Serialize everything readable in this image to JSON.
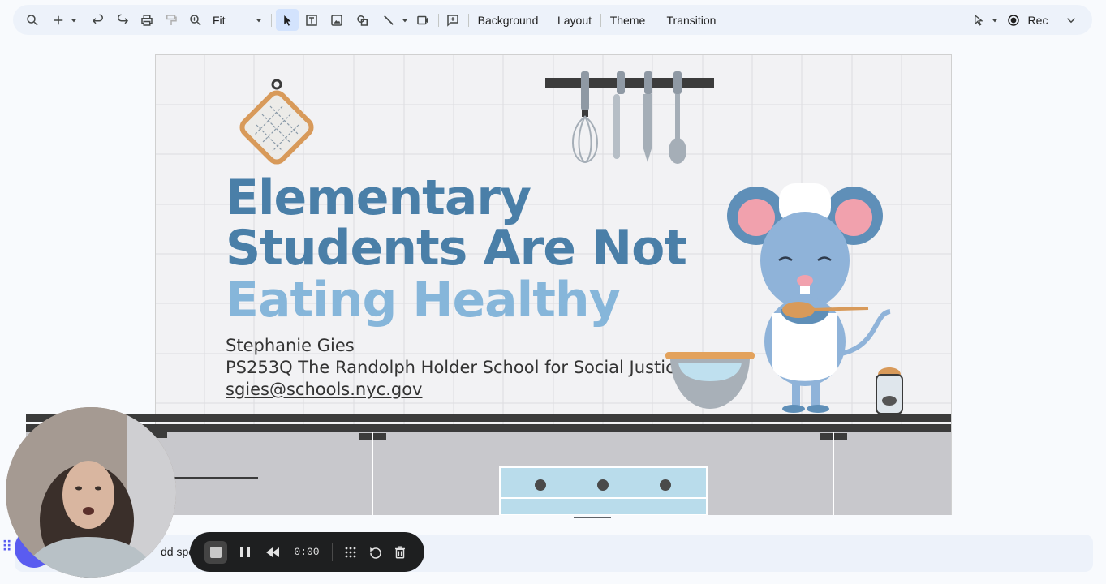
{
  "toolbar": {
    "zoom_label": "Fit",
    "background_label": "Background",
    "layout_label": "Layout",
    "theme_label": "Theme",
    "transition_label": "Transition",
    "rec_label": "Rec"
  },
  "slide": {
    "title_line1": "Elementary",
    "title_line2": "Students Are Not",
    "title_line3": "Eating Healthy",
    "author": "Stephanie Gies",
    "school": "PS253Q The Randolph Holder School for Social Justice",
    "email": "sgies@schools.nyc.gov"
  },
  "notes": {
    "placeholder_visible": "dd speal"
  },
  "recorder": {
    "time": "0:00"
  },
  "colors": {
    "title_dark": "#4a7fa8",
    "title_light": "#86b6da",
    "accent": "#5a5cf0"
  }
}
